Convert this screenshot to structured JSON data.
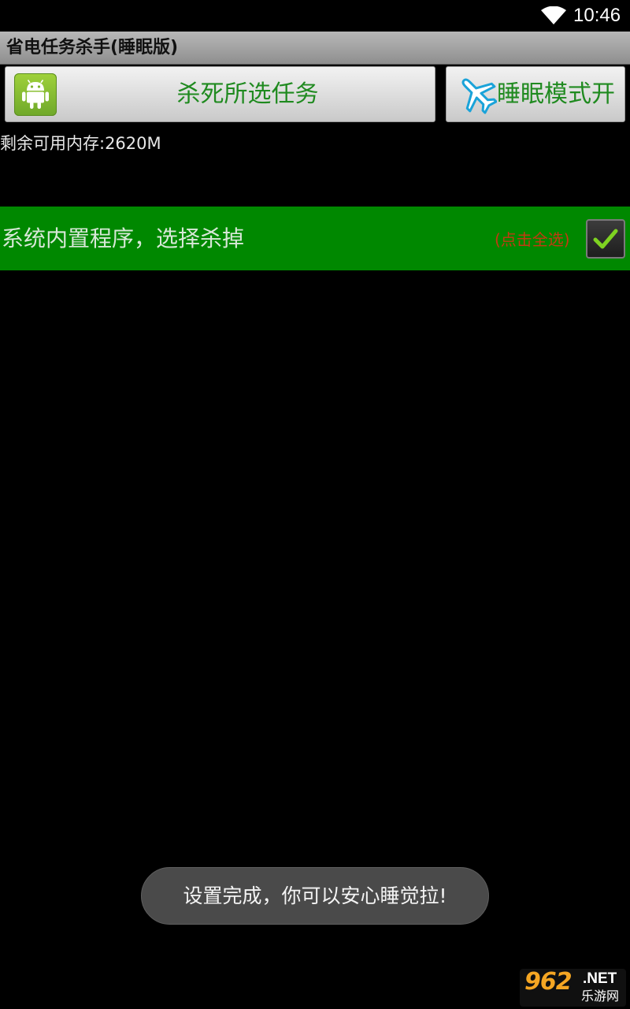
{
  "status_bar": {
    "time": "10:46",
    "icons": [
      "wifi-icon"
    ]
  },
  "app": {
    "title": "省电任务杀手(睡眠版)"
  },
  "toolbar": {
    "kill_button_label": "杀死所选任务",
    "kill_button_icon": "android-icon",
    "sleep_button_label": "睡眠模式开",
    "sleep_button_icon": "airplane-icon",
    "accent_color": "#1f8a1f"
  },
  "memory": {
    "text": "剩余可用内存:2620M"
  },
  "system_row": {
    "label": "系统内置程序，选择杀掉",
    "select_all_hint": "(点击全选)",
    "checked": true,
    "background_color": "#008800"
  },
  "toast": {
    "message": "设置完成，你可以安心睡觉拉!"
  },
  "watermark": {
    "main": "962",
    "suffix": ".NET",
    "sub": "乐游网"
  }
}
